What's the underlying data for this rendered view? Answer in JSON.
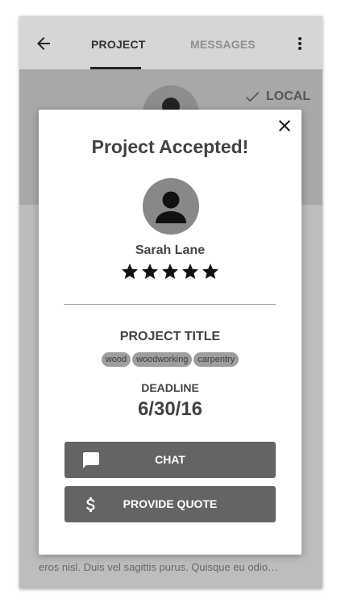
{
  "appbar": {
    "tabs": [
      {
        "label": "PROJECT",
        "active": true
      },
      {
        "label": "MESSAGES",
        "active": false
      }
    ],
    "back_icon": "arrow-back-icon",
    "more_icon": "more-vert-icon"
  },
  "header": {
    "local_label": "LOCAL",
    "local_icon": "check-icon"
  },
  "content": {
    "body_text": "eros nisl. Duis vel sagittis purus. Quisque eu odio…"
  },
  "dialog": {
    "title": "Project Accepted!",
    "close_icon": "close-icon",
    "user": {
      "name": "Sarah Lane",
      "rating": 5,
      "rating_max": 5
    },
    "project_title": "PROJECT TITLE",
    "tags": [
      "wood",
      "woodworking",
      "carpentry"
    ],
    "deadline_label": "DEADLINE",
    "deadline_value": "6/30/16",
    "chat_label": "CHAT",
    "chat_icon": "chat-icon",
    "quote_label": "PROVIDE QUOTE",
    "quote_icon": "dollar-icon"
  },
  "colors": {
    "appbar": "#d6d6d6",
    "header": "#a8a8a8",
    "button": "#646464",
    "tag": "#9e9e9e"
  }
}
